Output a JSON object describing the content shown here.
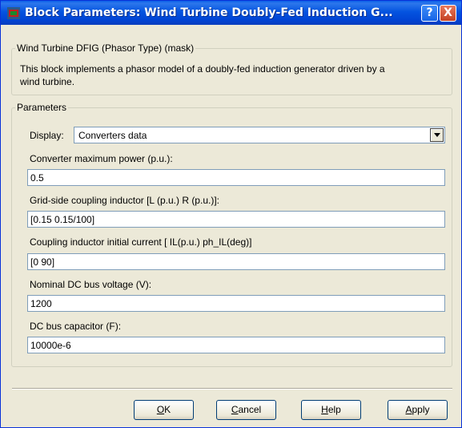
{
  "window": {
    "title": "Block Parameters: Wind Turbine Doubly-Fed Induction G...",
    "help_label": "?",
    "close_label": "X"
  },
  "mask": {
    "legend": "Wind Turbine DFIG (Phasor Type) (mask)",
    "description_line1": "This block implements a phasor model of a doubly-fed induction generator driven by a",
    "description_line2": "wind turbine."
  },
  "parameters": {
    "legend": "Parameters",
    "display_label": "Display:",
    "display_value": "Converters data",
    "fields": [
      {
        "label": "Converter maximum power (p.u.):",
        "value": "0.5"
      },
      {
        "label": "Grid-side coupling inductor [L (p.u.) R (p.u.)]:",
        "value": "[0.15 0.15/100]"
      },
      {
        "label": "Coupling inductor initial current [ IL(p.u.) ph_IL(deg)]",
        "value": "[0 90]"
      },
      {
        "label": "Nominal DC bus voltage (V):",
        "value": "1200"
      },
      {
        "label": "DC bus capacitor (F):",
        "value": "10000e-6"
      }
    ]
  },
  "buttons": {
    "ok_first": "O",
    "ok_rest": "K",
    "cancel_first": "C",
    "cancel_rest": "ancel",
    "help_first": "H",
    "help_rest": "elp",
    "apply_first": "A",
    "apply_rest": "pply"
  }
}
